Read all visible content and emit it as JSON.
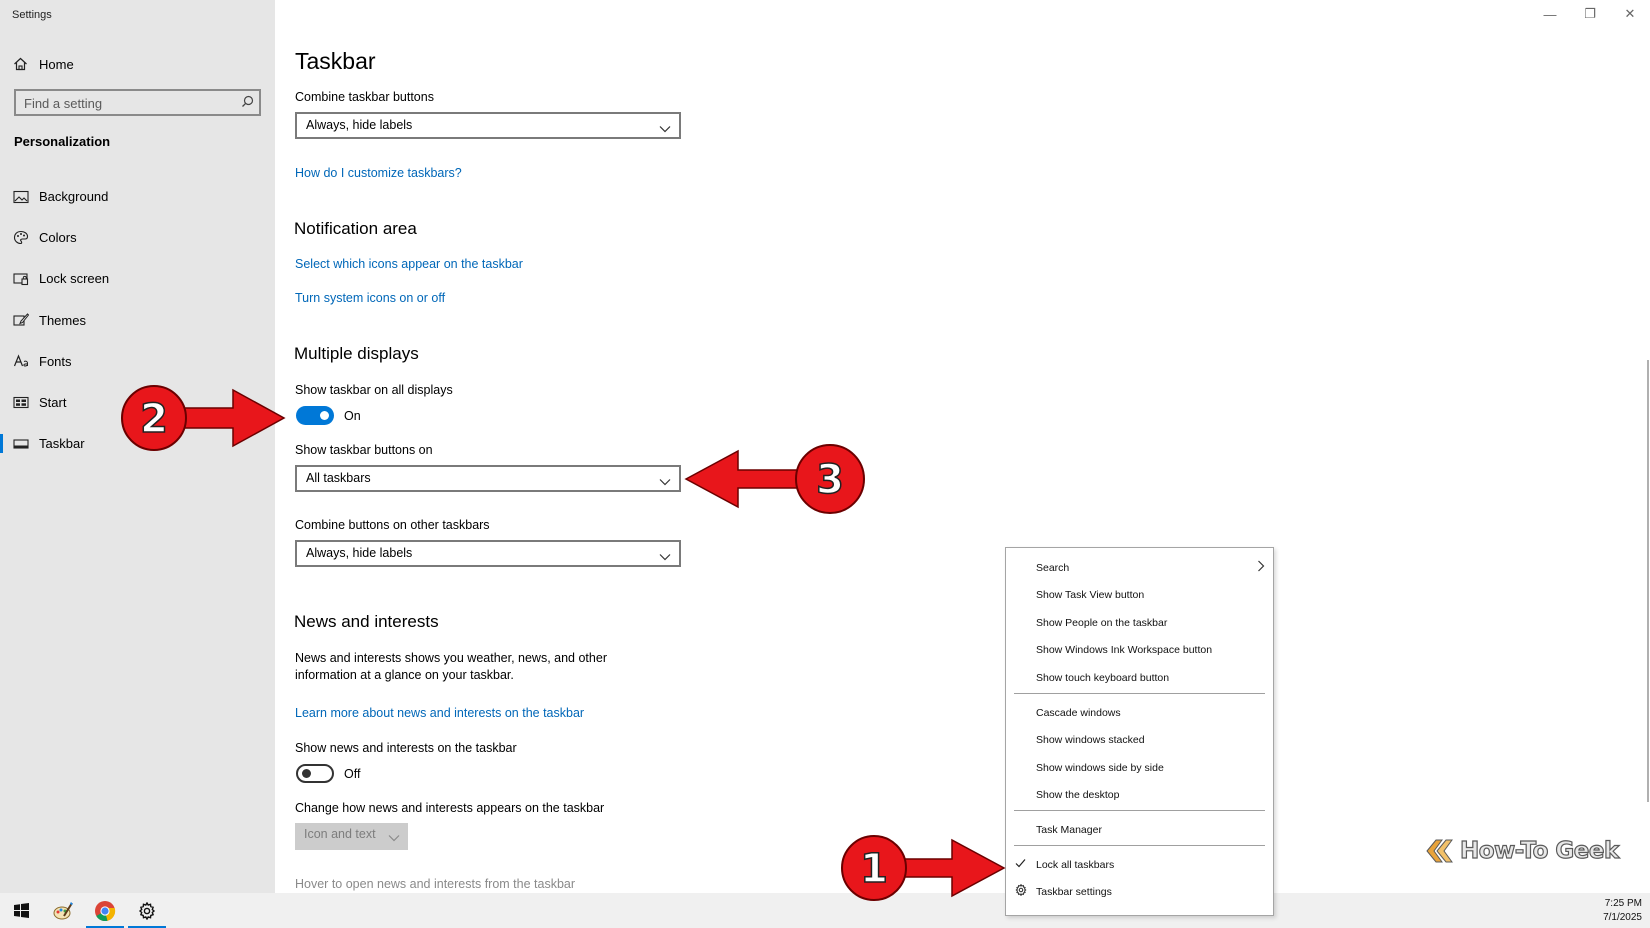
{
  "window": {
    "title": "Settings",
    "controls": {
      "minimize": "—",
      "restore": "❐",
      "close": "✕"
    }
  },
  "sidebar": {
    "home_label": "Home",
    "search_placeholder": "Find a setting",
    "section_title": "Personalization",
    "items": [
      {
        "label": "Background",
        "icon": "image-icon"
      },
      {
        "label": "Colors",
        "icon": "palette-icon"
      },
      {
        "label": "Lock screen",
        "icon": "lock-screen-icon"
      },
      {
        "label": "Themes",
        "icon": "brush-icon"
      },
      {
        "label": "Fonts",
        "icon": "font-icon"
      },
      {
        "label": "Start",
        "icon": "start-tiles-icon"
      },
      {
        "label": "Taskbar",
        "icon": "taskbar-icon",
        "active": true
      }
    ]
  },
  "main": {
    "title": "Taskbar",
    "combine_label": "Combine taskbar buttons",
    "combine_value": "Always, hide labels",
    "customize_link": "How do I customize taskbars?",
    "notification": {
      "heading": "Notification area",
      "link_icons": "Select which icons appear on the taskbar",
      "link_system": "Turn system icons on or off"
    },
    "multi": {
      "heading": "Multiple displays",
      "show_all_label": "Show taskbar on all displays",
      "show_all_state": "On",
      "buttons_on_label": "Show taskbar buttons on",
      "buttons_on_value": "All taskbars",
      "combine_other_label": "Combine buttons on other taskbars",
      "combine_other_value": "Always, hide labels"
    },
    "news": {
      "heading": "News and interests",
      "description": "News and interests shows you weather, news, and other information at a glance on your taskbar.",
      "learn_link": "Learn more about news and interests on the taskbar",
      "show_label": "Show news and interests on the taskbar",
      "show_state": "Off",
      "change_label": "Change how news and interests appears on the taskbar",
      "change_value": "Icon and text",
      "hover_label": "Hover to open news and interests from the taskbar"
    }
  },
  "context_menu": {
    "items": [
      {
        "label": "Search",
        "submenu": true
      },
      {
        "label": "Show Task View button"
      },
      {
        "label": "Show People on the taskbar"
      },
      {
        "label": "Show Windows Ink Workspace button"
      },
      {
        "label": "Show touch keyboard button"
      },
      {
        "label": "Cascade windows"
      },
      {
        "label": "Show windows stacked"
      },
      {
        "label": "Show windows side by side"
      },
      {
        "label": "Show the desktop"
      },
      {
        "label": "Task Manager"
      },
      {
        "label": "Lock all taskbars",
        "checked": true
      },
      {
        "label": "Taskbar settings",
        "icon": "gear-icon"
      }
    ]
  },
  "annotations": [
    {
      "number": "1",
      "color": "#e8161b"
    },
    {
      "number": "2",
      "color": "#e8161b"
    },
    {
      "number": "3",
      "color": "#e8161b"
    }
  ],
  "watermark": {
    "text": "How-To Geek"
  },
  "taskbar": {
    "apps": [
      "windows-start-icon",
      "paint-icon",
      "chrome-icon",
      "settings-gear-icon"
    ],
    "time": "7:25 PM",
    "date": "7/1/2025"
  },
  "colors": {
    "accent": "#0078d7",
    "link": "#0067b8",
    "sidebar_bg": "#e6e6e6",
    "annotation_red": "#e8161b"
  }
}
